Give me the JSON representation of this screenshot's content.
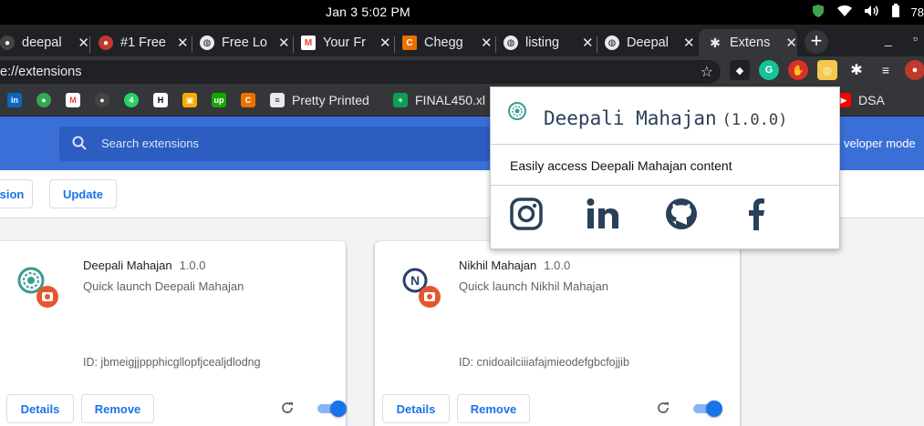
{
  "os": {
    "clock": "Jan 3   5:02 PM",
    "battery": "78"
  },
  "tabs": [
    {
      "title": "deepal",
      "favicon": "github-icon",
      "color": "#444"
    },
    {
      "title": "#1 Free",
      "favicon": "avatar-icon",
      "color": "#c0392b"
    },
    {
      "title": "Free Lo",
      "favicon": "globe-icon",
      "color": "#888"
    },
    {
      "title": "Your Fr",
      "favicon": "gmail-icon",
      "color": "#ea4335"
    },
    {
      "title": "Chegg",
      "favicon": "chegg-icon",
      "color": "#eb7100"
    },
    {
      "title": "listing",
      "favicon": "globe-icon",
      "color": "#888"
    },
    {
      "title": "Deepal",
      "favicon": "globe-icon",
      "color": "#888"
    },
    {
      "title": "Extens",
      "favicon": "puzzle-icon",
      "color": "#e8eaed"
    }
  ],
  "omnibox": {
    "url": "e://extensions"
  },
  "bookmarks": {
    "items": [
      {
        "label": "Pretty Printed"
      },
      {
        "label": "FINAL450.xl"
      },
      {
        "label": "DSA"
      }
    ]
  },
  "header": {
    "search_placeholder": "Search extensions",
    "developer_mode": "veloper mode"
  },
  "actions": {
    "pack": "sion",
    "update": "Update"
  },
  "extensions": [
    {
      "name": "Deepali Mahajan",
      "version": "1.0.0",
      "description": "Quick launch Deepali Mahajan",
      "id": "ID: jbmeigjjppphicgllopfjcealjdlodng",
      "details": "Details",
      "remove": "Remove",
      "enabled": true
    },
    {
      "name": "Nikhil Mahajan",
      "version": "1.0.0",
      "description": "Quick launch Nikhil Mahajan",
      "id": "ID: cnidoailciiiafajmieodefgbcfojjib",
      "details": "Details",
      "remove": "Remove",
      "enabled": true
    }
  ],
  "popup": {
    "title": "Deepali Mahajan",
    "version": "(1.0.0)",
    "description": "Easily access Deepali Mahajan content",
    "social": [
      "instagram-icon",
      "linkedin-icon",
      "github-icon",
      "facebook-icon"
    ]
  },
  "colors": {
    "header_blue": "#3a6fd8",
    "accent": "#1a73e8",
    "popup_title": "#2a3f5a"
  }
}
